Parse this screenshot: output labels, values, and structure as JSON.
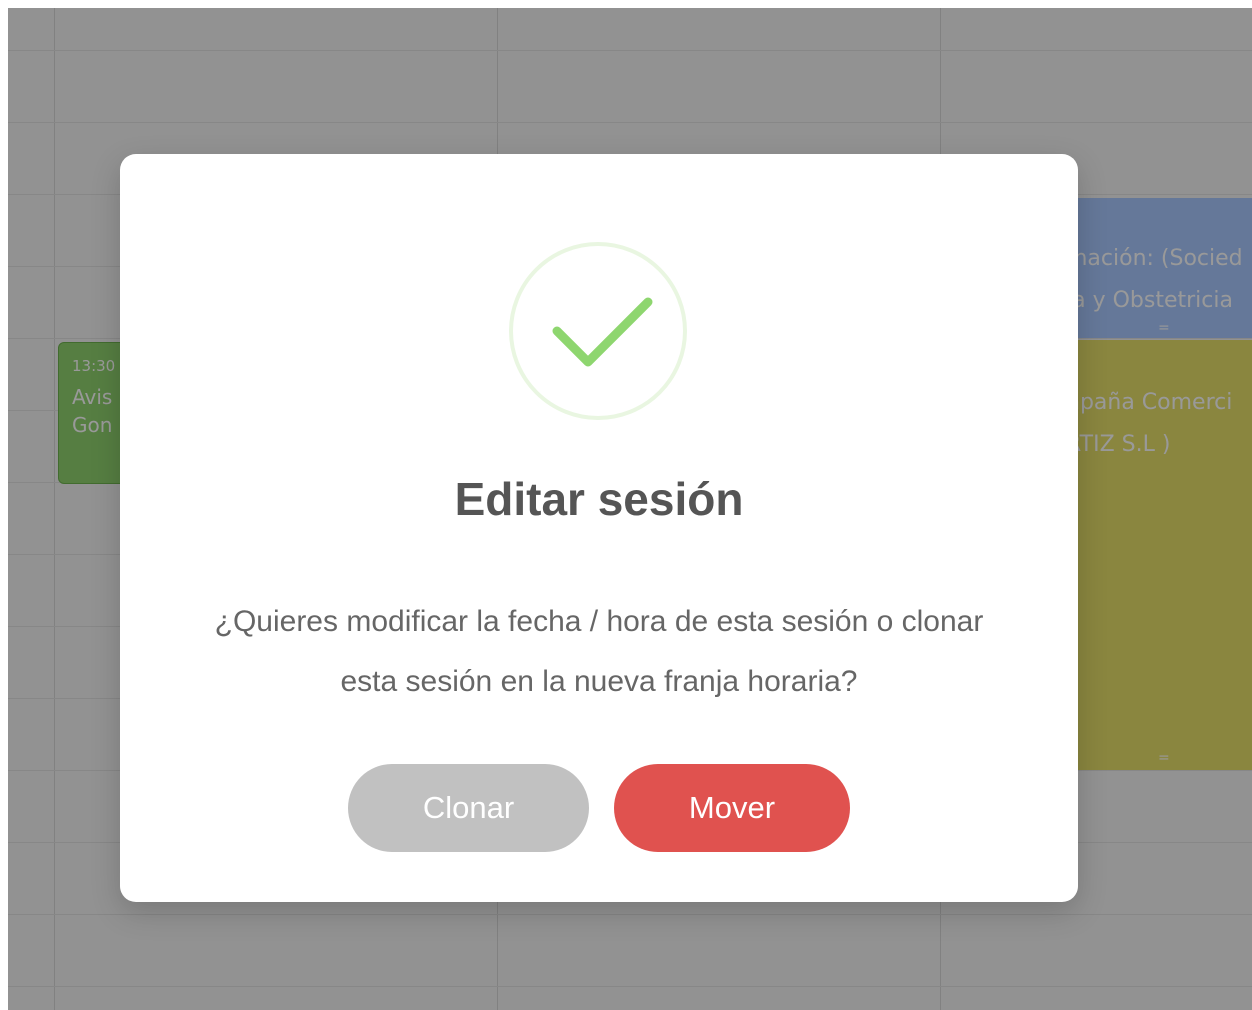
{
  "calendar": {
    "events": [
      {
        "time": "13:30",
        "title": "Avis\nGon",
        "color": "#8fd36f"
      },
      {
        "line1": "mación: (Socied",
        "line2": "ía y Obstetricia",
        "grip": "=",
        "color": "#a8c8ff"
      },
      {
        "line1": "npaña Comerci",
        "line2": "RTIZ S.L )",
        "grip": "=",
        "color": "#e6e06a"
      }
    ]
  },
  "modal": {
    "icon": "check-circle-icon",
    "icon_color": "#8ed66f",
    "title": "Editar sesión",
    "message": "¿Quieres modificar la fecha / hora de esta sesión o clonar esta sesión en la nueva franja horaria?",
    "buttons": {
      "clone_label": "Clonar",
      "move_label": "Mover"
    },
    "colors": {
      "clone": "#c1c1c1",
      "move": "#e0524f"
    }
  }
}
